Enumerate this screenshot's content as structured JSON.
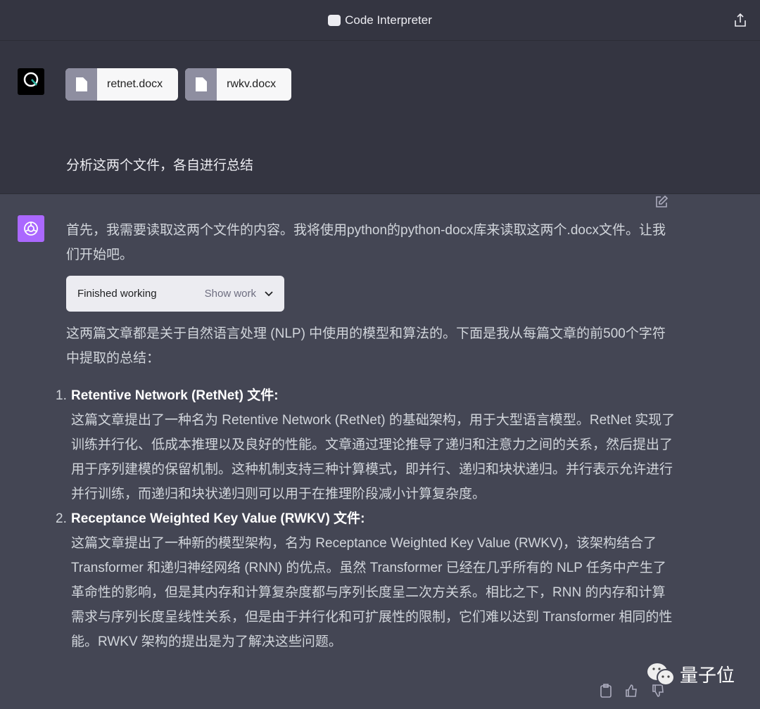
{
  "header": {
    "title": "Code Interpreter",
    "icon": "code-interpreter-icon",
    "share_icon": "share-icon"
  },
  "user": {
    "files": [
      {
        "name": "retnet.docx",
        "icon": "file-icon"
      },
      {
        "name": "rwkv.docx",
        "icon": "file-icon"
      }
    ],
    "message": "分析这两个文件，各自进行总结"
  },
  "assistant": {
    "intro": "首先，我需要读取这两个文件的内容。我将使用python的python-docx库来读取这两个.docx文件。让我们开始吧。",
    "work_status": "Finished working",
    "show_work": "Show work",
    "summary_intro": "这两篇文章都是关于自然语言处理 (NLP) 中使用的模型和算法的。下面是我从每篇文章的前500个字符中提取的总结：",
    "items": [
      {
        "num": "1.",
        "title": "Retentive Network (RetNet) 文件",
        "body": "这篇文章提出了一种名为 Retentive Network (RetNet) 的基础架构，用于大型语言模型。RetNet 实现了训练并行化、低成本推理以及良好的性能。文章通过理论推导了递归和注意力之间的关系，然后提出了用于序列建模的保留机制。这种机制支持三种计算模式，即并行、递归和块状递归。并行表示允许进行并行训练，而递归和块状递归则可以用于在推理阶段减小计算复杂度。"
      },
      {
        "num": "2.",
        "title": "Receptance Weighted Key Value (RWKV) 文件",
        "body": "这篇文章提出了一种新的模型架构，名为 Receptance Weighted Key Value (RWKV)，该架构结合了 Transformer 和递归神经网络 (RNN) 的优点。虽然 Transformer 已经在几乎所有的 NLP 任务中产生了革命性的影响，但是其内存和计算复杂度都与序列长度呈二次方关系。相比之下，RNN 的内存和计算需求与序列长度呈线性关系，但是由于并行化和可扩展性的限制，它们难以达到 Transformer 相同的性能。RWKV 架构的提出是为了解决这些问题。"
      }
    ]
  },
  "watermark": {
    "text": "量子位"
  },
  "colors": {
    "top_bg": "#343541",
    "assistant_bg": "#444654",
    "assistant_avatar": "#ab68ff"
  }
}
